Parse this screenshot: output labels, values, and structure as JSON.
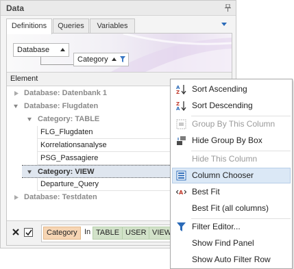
{
  "panel": {
    "title": "Data"
  },
  "tabs": [
    {
      "label": "Definitions",
      "active": true
    },
    {
      "label": "Queries",
      "active": false
    },
    {
      "label": "Variables",
      "active": false
    }
  ],
  "group_panel": {
    "boxes": [
      {
        "label": "Database",
        "sort": "ascending"
      },
      {
        "label": "Category",
        "sort": "ascending",
        "filtered": true
      }
    ]
  },
  "grid": {
    "column_header": "Element",
    "rows": [
      {
        "kind": "group",
        "level": 0,
        "expanded": false,
        "text": "Database: Datenbank 1"
      },
      {
        "kind": "group",
        "level": 0,
        "expanded": true,
        "text": "Database: Flugdaten"
      },
      {
        "kind": "group",
        "level": 1,
        "expanded": true,
        "text": "Category: TABLE"
      },
      {
        "kind": "data",
        "text": "FLG_Flugdaten"
      },
      {
        "kind": "data",
        "text": "Korrelationsanalyse"
      },
      {
        "kind": "data",
        "text": "PSG_Passagiere"
      },
      {
        "kind": "group",
        "level": 1,
        "expanded": true,
        "selected": true,
        "text": "Category: VIEW"
      },
      {
        "kind": "data",
        "text": "Departure_Query"
      },
      {
        "kind": "group",
        "level": 0,
        "expanded": false,
        "text": "Database: Testdaten"
      }
    ]
  },
  "filter_bar": {
    "checked": true,
    "chips": [
      {
        "text": "Category",
        "style": "orange"
      },
      {
        "text": "In",
        "style": "plain"
      },
      {
        "text": "TABLE",
        "style": "green"
      },
      {
        "text": "USER",
        "style": "green"
      },
      {
        "text": "VIEW",
        "style": "green"
      }
    ]
  },
  "context_menu": {
    "items": [
      {
        "label": "Sort Ascending",
        "icon": "sort-ascending-icon",
        "enabled": true
      },
      {
        "label": "Sort Descending",
        "icon": "sort-descending-icon",
        "enabled": true
      },
      {
        "separator": true
      },
      {
        "label": "Group By This Column",
        "icon": "group-by-column-icon",
        "enabled": false
      },
      {
        "label": "Hide Group By Box",
        "icon": "group-by-box-icon",
        "enabled": true
      },
      {
        "separator": true
      },
      {
        "label": "Hide This Column",
        "icon": "",
        "enabled": false
      },
      {
        "label": "Column Chooser",
        "icon": "column-chooser-icon",
        "enabled": true,
        "highlighted": true
      },
      {
        "label": "Best Fit",
        "icon": "best-fit-icon",
        "enabled": true
      },
      {
        "label": "Best Fit (all columns)",
        "icon": "",
        "enabled": true
      },
      {
        "separator": true
      },
      {
        "label": "Filter Editor...",
        "icon": "filter-icon",
        "enabled": true
      },
      {
        "label": "Show Find Panel",
        "icon": "",
        "enabled": true
      },
      {
        "label": "Show Auto Filter Row",
        "icon": "",
        "enabled": true
      }
    ]
  },
  "colors": {
    "accent": "#1f6fc5",
    "selection": "#dfe6ef",
    "menu_highlight": "#dbe8f6",
    "chip_orange": "#f6d5b4",
    "chip_green": "#d2e2c9"
  }
}
